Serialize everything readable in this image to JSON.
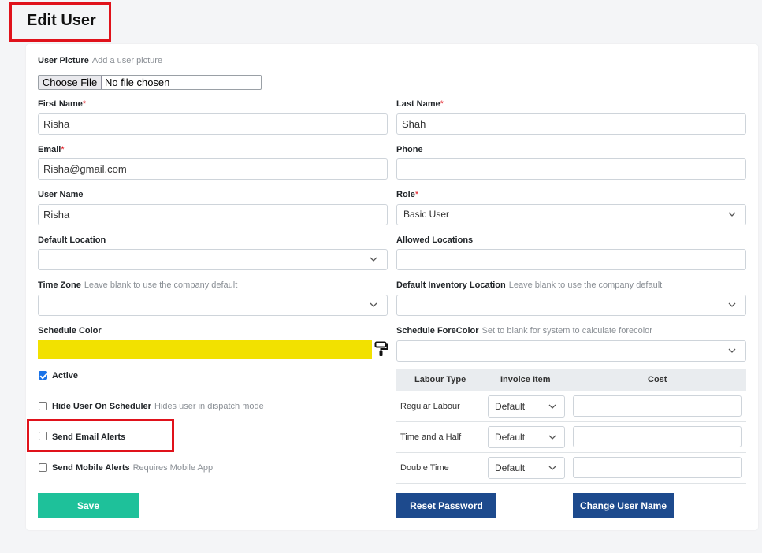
{
  "page_title": "Edit User",
  "user_picture": {
    "label": "User Picture",
    "hint": "Add a user picture",
    "button": "Choose File",
    "status": "No file chosen"
  },
  "first_name": {
    "label": "First Name",
    "required": "*",
    "value": "Risha"
  },
  "last_name": {
    "label": "Last Name",
    "required": "*",
    "value": "Shah"
  },
  "email": {
    "label": "Email",
    "required": "*",
    "value": "Risha@gmail.com"
  },
  "phone": {
    "label": "Phone",
    "value": ""
  },
  "user_name": {
    "label": "User Name",
    "value": "Risha"
  },
  "role": {
    "label": "Role",
    "required": "*",
    "value": "Basic User"
  },
  "default_location": {
    "label": "Default Location",
    "value": ""
  },
  "allowed_locations": {
    "label": "Allowed Locations",
    "value": ""
  },
  "time_zone": {
    "label": "Time Zone",
    "hint": "Leave blank to use the company default",
    "value": ""
  },
  "default_inventory_location": {
    "label": "Default Inventory Location",
    "hint": "Leave blank to use the company default",
    "value": ""
  },
  "schedule_color": {
    "label": "Schedule Color",
    "color": "#f2e100",
    "icon": "paint-roller-icon"
  },
  "schedule_forecolor": {
    "label": "Schedule ForeColor",
    "hint": "Set to blank for system to calculate forecolor",
    "value": ""
  },
  "checkboxes": {
    "active": {
      "label": "Active",
      "checked": true
    },
    "hide_user": {
      "label": "Hide User On Scheduler",
      "hint": "Hides user in dispatch mode",
      "checked": false
    },
    "email_alerts": {
      "label": "Send Email Alerts",
      "checked": false
    },
    "mobile_alerts": {
      "label": "Send Mobile Alerts",
      "hint": "Requires Mobile App",
      "checked": false
    }
  },
  "labour_table": {
    "headers": [
      "Labour Type",
      "Invoice Item",
      "Cost"
    ],
    "rows": [
      {
        "type": "Regular Labour",
        "item": "Default",
        "cost": ""
      },
      {
        "type": "Time and a Half",
        "item": "Default",
        "cost": ""
      },
      {
        "type": "Double Time",
        "item": "Default",
        "cost": ""
      }
    ]
  },
  "buttons": {
    "save": "Save",
    "reset_password": "Reset Password",
    "change_user_name": "Change User Name"
  },
  "colors": {
    "save": "#1ec19a",
    "primary": "#1d4a8d",
    "highlight": "#e0121b",
    "checkbox": "#1a73e8"
  }
}
